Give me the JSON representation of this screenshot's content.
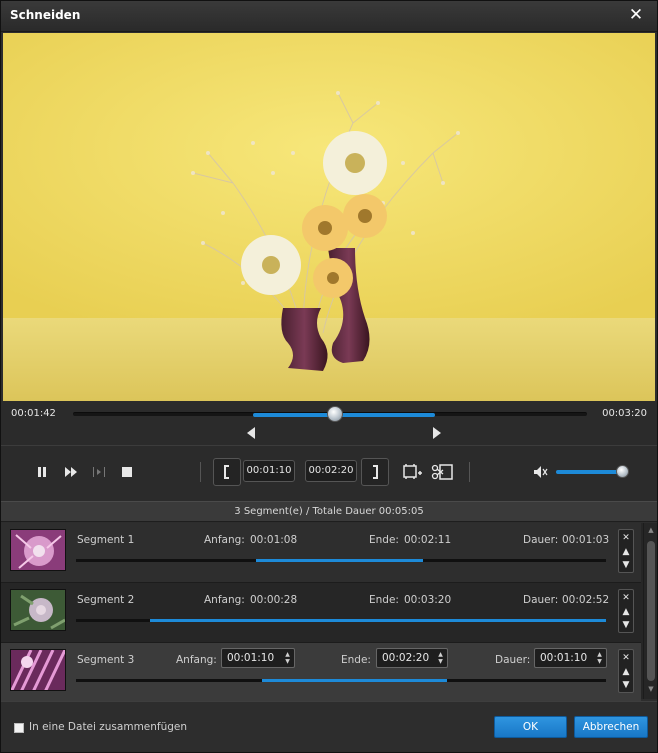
{
  "window": {
    "title": "Schneiden"
  },
  "player": {
    "current_time": "00:01:42",
    "total_time": "00:03:20",
    "position_fraction": 0.51,
    "selection_start_fraction": 0.35,
    "selection_end_fraction": 0.705
  },
  "controls": {
    "start_time": "00:01:10",
    "end_time": "00:02:20",
    "volume_fraction": 0.95
  },
  "segments": {
    "summary": "3 Segment(e) / Totale Dauer 00:05:05",
    "start_label": "Anfang:",
    "end_label": "Ende:",
    "duration_label": "Dauer:",
    "items": [
      {
        "name": "Segment 1",
        "start": "00:01:08",
        "end": "00:02:11",
        "duration": "00:01:03",
        "fill_start": 0.34,
        "fill_end": 0.655
      },
      {
        "name": "Segment 2",
        "start": "00:00:28",
        "end": "00:03:20",
        "duration": "00:02:52",
        "fill_start": 0.14,
        "fill_end": 1.0
      },
      {
        "name": "Segment 3",
        "start": "00:01:10",
        "end": "00:02:20",
        "duration": "00:01:10",
        "fill_start": 0.35,
        "fill_end": 0.7
      }
    ]
  },
  "footer": {
    "merge_label": "In eine Datei zusammenfügen",
    "ok_label": "OK",
    "cancel_label": "Abbrechen"
  },
  "colors": {
    "accent": "#1d8ad8",
    "video_bg": "#f2dd66"
  },
  "icons": [
    "close-icon",
    "pause-icon",
    "fast-forward-icon",
    "next-frame-icon",
    "stop-icon",
    "set-start-icon",
    "set-end-icon",
    "add-segment-icon",
    "cut-icon",
    "volume-icon",
    "delete-icon",
    "move-up-icon",
    "move-down-icon"
  ]
}
